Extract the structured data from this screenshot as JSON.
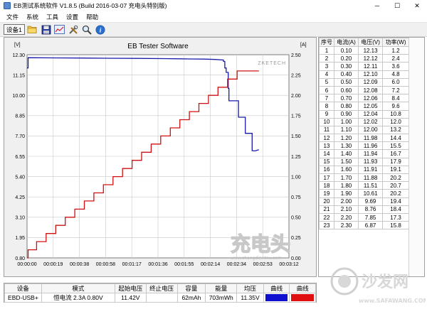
{
  "window": {
    "title": "EB测试系统软件 V1.8.5 (Build 2016-03-07 充电头特别版)",
    "minimize_glyph": "─",
    "maximize_glyph": "☐",
    "close_glyph": "✕"
  },
  "menu": [
    "文件",
    "系统",
    "工具",
    "设置",
    "帮助"
  ],
  "toolbar": {
    "device_label": "设备1",
    "icons": [
      "folder-icon",
      "save-icon",
      "chart-icon",
      "tools-icon",
      "search-icon",
      "info-icon"
    ]
  },
  "chart": {
    "title": "EB Tester Software",
    "left_unit": "[V]",
    "right_unit": "[A]",
    "brand_label": "ZKETECH",
    "colors": {
      "voltage": "#1a1aa8",
      "current": "#d01010",
      "grid": "#c8c8c8",
      "background": "#ffffff"
    }
  },
  "chart_data": {
    "type": "line",
    "title": "EB Tester Software",
    "y_left": {
      "unit": "[V]",
      "range": [
        0.8,
        12.3
      ],
      "ticks": [
        "12.30",
        "11.15",
        "10.00",
        "8.85",
        "7.70",
        "6.55",
        "5.40",
        "4.25",
        "3.10",
        "1.95",
        "0.80"
      ]
    },
    "y_right": {
      "unit": "[A]",
      "range": [
        0.0,
        2.5
      ],
      "ticks": [
        "2.50",
        "2.25",
        "2.00",
        "1.75",
        "1.50",
        "1.25",
        "1.00",
        "0.75",
        "0.50",
        "0.25",
        "0.00"
      ]
    },
    "x_ticks": [
      "00:00:00",
      "00:00:19",
      "00:00:38",
      "00:00:58",
      "00:01:17",
      "00:01:36",
      "00:01:55",
      "00:02:14",
      "00:02:34",
      "00:02:53",
      "00:03:12"
    ],
    "x_range_seconds": [
      0,
      192
    ],
    "grid": true,
    "series": [
      {
        "axis": "left",
        "points": [
          [
            0,
            11.55
          ],
          [
            0.8,
            11.55
          ],
          [
            0.8,
            12.13
          ],
          [
            20,
            12.12
          ],
          [
            40,
            12.11
          ],
          [
            60,
            12.1
          ],
          [
            80,
            12.09
          ],
          [
            100,
            12.08
          ],
          [
            120,
            12.06
          ],
          [
            130,
            12.05
          ],
          [
            138,
            12.03
          ],
          [
            144,
            12.0
          ],
          [
            144,
            11.92
          ],
          [
            145,
            11.92
          ],
          [
            145,
            11.55
          ],
          [
            146,
            11.55
          ],
          [
            146,
            11.3
          ],
          [
            147.5,
            11.3
          ],
          [
            147.5,
            10.4
          ],
          [
            148,
            10.4
          ],
          [
            148,
            9.69
          ],
          [
            155,
            9.69
          ],
          [
            155,
            8.76
          ],
          [
            160,
            8.76
          ],
          [
            160,
            7.85
          ],
          [
            165,
            7.85
          ],
          [
            165,
            6.87
          ],
          [
            167,
            6.85
          ],
          [
            170,
            6.92
          ]
        ]
      },
      {
        "axis": "right",
        "points": [
          [
            0,
            0.0
          ],
          [
            0.8,
            0.0
          ],
          [
            0.8,
            0.1
          ],
          [
            7,
            0.1
          ],
          [
            7,
            0.2
          ],
          [
            14,
            0.2
          ],
          [
            14,
            0.3
          ],
          [
            21,
            0.3
          ],
          [
            21,
            0.4
          ],
          [
            28,
            0.4
          ],
          [
            28,
            0.5
          ],
          [
            35,
            0.5
          ],
          [
            35,
            0.6
          ],
          [
            42,
            0.6
          ],
          [
            42,
            0.7
          ],
          [
            49,
            0.7
          ],
          [
            49,
            0.8
          ],
          [
            56,
            0.8
          ],
          [
            56,
            0.9
          ],
          [
            63,
            0.9
          ],
          [
            63,
            1.0
          ],
          [
            70,
            1.0
          ],
          [
            70,
            1.1
          ],
          [
            77,
            1.1
          ],
          [
            77,
            1.2
          ],
          [
            84,
            1.2
          ],
          [
            84,
            1.3
          ],
          [
            91,
            1.3
          ],
          [
            91,
            1.4
          ],
          [
            98,
            1.4
          ],
          [
            98,
            1.5
          ],
          [
            105,
            1.5
          ],
          [
            105,
            1.6
          ],
          [
            112,
            1.6
          ],
          [
            112,
            1.7
          ],
          [
            119,
            1.7
          ],
          [
            119,
            1.8
          ],
          [
            126,
            1.8
          ],
          [
            126,
            1.9
          ],
          [
            133,
            1.9
          ],
          [
            133,
            2.0
          ],
          [
            140,
            2.0
          ],
          [
            140,
            2.1
          ],
          [
            147,
            2.1
          ],
          [
            147,
            2.2
          ],
          [
            154,
            2.2
          ],
          [
            154,
            2.3
          ],
          [
            170,
            2.3
          ]
        ]
      }
    ]
  },
  "table": {
    "headers": [
      "序号",
      "电流(A)",
      "电压(V)",
      "功率(W)"
    ],
    "rows": [
      [
        "1",
        "0.10",
        "12.13",
        "1.2"
      ],
      [
        "2",
        "0.20",
        "12.12",
        "2.4"
      ],
      [
        "3",
        "0.30",
        "12.11",
        "3.6"
      ],
      [
        "4",
        "0.40",
        "12.10",
        "4.8"
      ],
      [
        "5",
        "0.50",
        "12.09",
        "6.0"
      ],
      [
        "6",
        "0.60",
        "12.08",
        "7.2"
      ],
      [
        "7",
        "0.70",
        "12.06",
        "8.4"
      ],
      [
        "8",
        "0.80",
        "12.05",
        "9.6"
      ],
      [
        "9",
        "0.90",
        "12.04",
        "10.8"
      ],
      [
        "10",
        "1.00",
        "12.02",
        "12.0"
      ],
      [
        "11",
        "1.10",
        "12.00",
        "13.2"
      ],
      [
        "12",
        "1.20",
        "11.98",
        "14.4"
      ],
      [
        "13",
        "1.30",
        "11.96",
        "15.5"
      ],
      [
        "14",
        "1.40",
        "11.94",
        "16.7"
      ],
      [
        "15",
        "1.50",
        "11.93",
        "17.9"
      ],
      [
        "16",
        "1.60",
        "11.91",
        "19.1"
      ],
      [
        "17",
        "1.70",
        "11.88",
        "20.2"
      ],
      [
        "18",
        "1.80",
        "11.51",
        "20.7"
      ],
      [
        "19",
        "1.90",
        "10.61",
        "20.2"
      ],
      [
        "20",
        "2.00",
        "9.69",
        "19.4"
      ],
      [
        "21",
        "2.10",
        "8.76",
        "18.4"
      ],
      [
        "22",
        "2.20",
        "7.85",
        "17.3"
      ],
      [
        "23",
        "2.30",
        "6.87",
        "15.8"
      ]
    ]
  },
  "status": {
    "headers": [
      "设备",
      "模式",
      "起始电压",
      "终止电压",
      "容量",
      "能量",
      "均压",
      "曲线",
      "曲线"
    ],
    "values": [
      "EBD-USB+",
      "恒电流  2.3A  0.80V",
      "11.42V",
      "",
      "62mAh",
      "703mWh",
      "11.35V"
    ],
    "curve_colors": [
      "#1010d0",
      "#e01010"
    ]
  },
  "watermarks": {
    "chart_logo": "充电头",
    "chart_url": "www.chongdiantou.com",
    "corner_logo": "沙发网",
    "corner_url": "www.SAFAWANG.COM"
  }
}
